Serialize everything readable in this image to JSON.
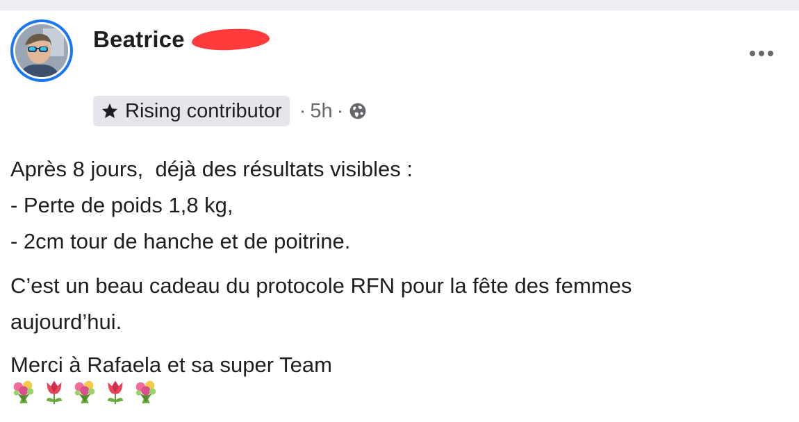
{
  "post": {
    "author": "Beatrice",
    "badge": "Rising contributor",
    "time": "5h",
    "separator": "·",
    "lines": [
      "Après 8 jours,  déjà des résultats visibles :",
      "- Perte de poids 1,8 kg,",
      "- 2cm tour de hanche et de poitrine.",
      "C’est un beau cadeau du protocole RFN pour la fête des femmes",
      "aujourd’hui.",
      "Merci à Rafaela et sa super Team"
    ],
    "emoji_sequence": [
      "bouquet-icon",
      "tulip-icon",
      "bouquet-icon",
      "tulip-icon",
      "bouquet-icon"
    ]
  },
  "icons": {
    "badge": "star-icon",
    "audience": "globe-icon",
    "menu": "more-options-icon"
  },
  "colors": {
    "avatar_ring": "#1877f2",
    "redaction": "#ff3b3b",
    "badge_bg": "#e4e6eb",
    "meta_text": "#65676b"
  }
}
